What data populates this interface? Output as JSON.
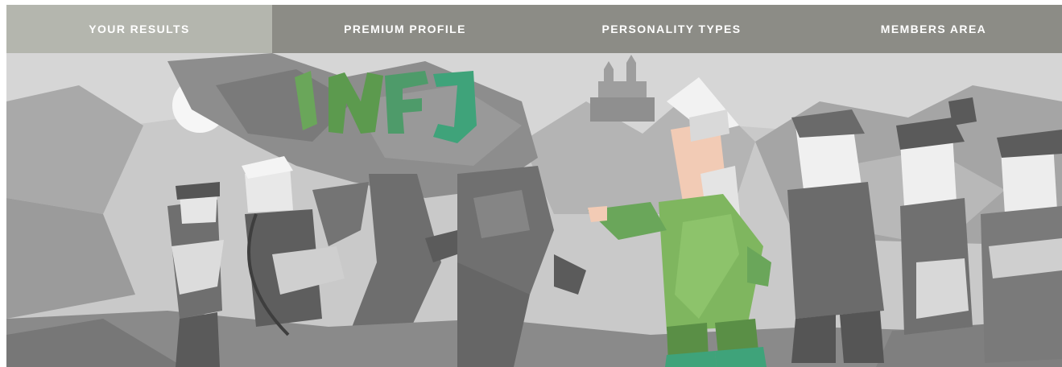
{
  "nav": {
    "items": [
      {
        "label": "YOUR RESULTS",
        "active": true
      },
      {
        "label": "PREMIUM PROFILE",
        "active": false
      },
      {
        "label": "PERSONALITY TYPES",
        "active": false
      },
      {
        "label": "MEMBERS AREA",
        "active": false
      }
    ]
  },
  "hero": {
    "type_code": "INFJ"
  },
  "colors": {
    "nav_bg": "#8c8c86",
    "nav_active_bg": "#b4b6ae",
    "nav_text": "#ffffff",
    "accent_green": "#6aa65a",
    "accent_teal": "#3fa37a"
  }
}
